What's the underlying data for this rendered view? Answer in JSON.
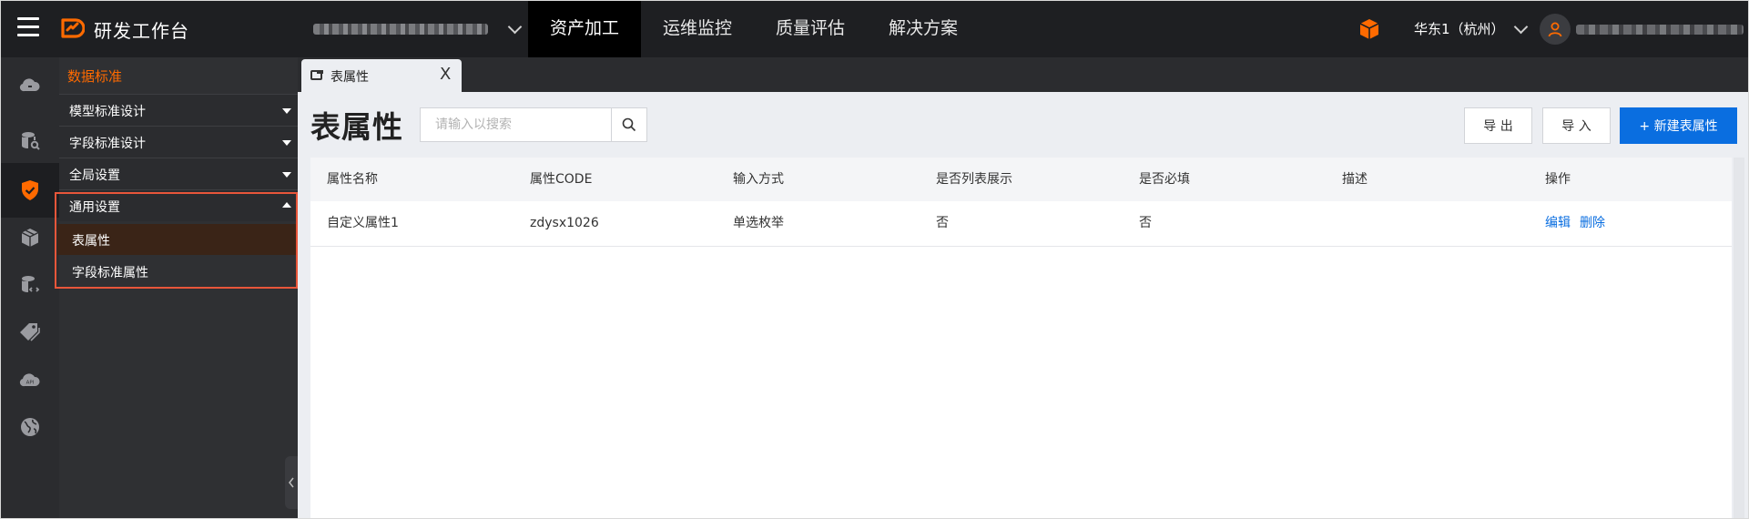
{
  "app": {
    "brand": "研发工作台"
  },
  "topbar": {
    "nav": [
      {
        "label": "资产加工",
        "active": true
      },
      {
        "label": "运维监控",
        "active": false
      },
      {
        "label": "质量评估",
        "active": false
      },
      {
        "label": "解决方案",
        "active": false
      }
    ],
    "region": "华东1（杭州）",
    "accent_color": "#ff6a00"
  },
  "rail": {
    "icons": [
      "cloud-icon",
      "database-search-icon",
      "shield-check-icon",
      "cubes-icon",
      "database-code-icon",
      "tags-icon",
      "api-cloud-icon",
      "globe-icon"
    ],
    "active_index": 2
  },
  "menu": {
    "title": "数据标准",
    "sections": [
      {
        "label": "模型标准设计",
        "expanded": false
      },
      {
        "label": "字段标准设计",
        "expanded": false
      },
      {
        "label": "全局设置",
        "expanded": false
      },
      {
        "label": "通用设置",
        "expanded": true
      }
    ],
    "sub_items": [
      {
        "label": "表属性",
        "active": true
      },
      {
        "label": "字段标准属性",
        "active": false
      }
    ]
  },
  "tabs": [
    {
      "label": "表属性",
      "close": "X"
    }
  ],
  "page": {
    "heading": "表属性",
    "search_placeholder": "请输入以搜索",
    "buttons": {
      "export": "导 出",
      "import": "导 入",
      "create": "+ 新建表属性"
    }
  },
  "table": {
    "columns": [
      "属性名称",
      "属性CODE",
      "输入方式",
      "是否列表展示",
      "是否必填",
      "描述",
      "操作"
    ],
    "rows": [
      {
        "name": "自定义属性1",
        "code": "zdysx1026",
        "input": "单选枚举",
        "list": "否",
        "required": "否",
        "desc": "",
        "actions": [
          "编辑",
          "删除"
        ]
      }
    ]
  },
  "colors": {
    "primary": "#0a6ee0",
    "topbar": "#1e1f22",
    "highlight": "#e8563a"
  }
}
